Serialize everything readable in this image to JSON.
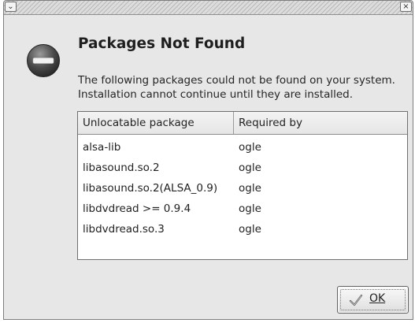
{
  "titlebar": {
    "menu_icon": "chevron-down-icon",
    "close_icon": "close-icon",
    "menu_glyph": "⌄",
    "close_glyph": "×"
  },
  "dialog": {
    "icon": "stop-icon",
    "title": "Packages Not Found",
    "message_line1": "The following packages could not be found on your system.",
    "message_line2": "Installation cannot continue until they are installed."
  },
  "table": {
    "headers": {
      "package": "Unlocatable package",
      "required_by": "Required by"
    },
    "rows": [
      {
        "package": "alsa-lib",
        "required_by": "ogle"
      },
      {
        "package": "libasound.so.2",
        "required_by": "ogle"
      },
      {
        "package": "libasound.so.2(ALSA_0.9)",
        "required_by": "ogle"
      },
      {
        "package": "libdvdread >= 0.9.4",
        "required_by": "ogle"
      },
      {
        "package": "libdvdread.so.3",
        "required_by": "ogle"
      }
    ]
  },
  "buttons": {
    "ok_label": "OK",
    "ok_icon": "checkmark-icon"
  }
}
